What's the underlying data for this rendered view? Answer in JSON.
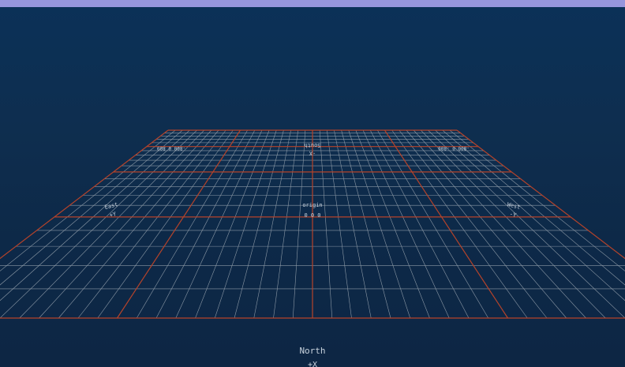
{
  "colors": {
    "title_bar": "#9696dc",
    "background_top": "#0b3158",
    "background_bottom": "#0d2644",
    "grid_minor": "#8c99a6",
    "grid_major": "#b5432a"
  },
  "labels": {
    "north": "North",
    "north_axis": "+X",
    "origin": "origin",
    "origin_coords": "0 0 0",
    "east": "East",
    "east_axis": "+Y",
    "west": "West",
    "west_axis": "-Y",
    "south": "South",
    "south_axis": "-X",
    "corner_left": "-800 0 800",
    "corner_right": "-800 0 -800"
  }
}
